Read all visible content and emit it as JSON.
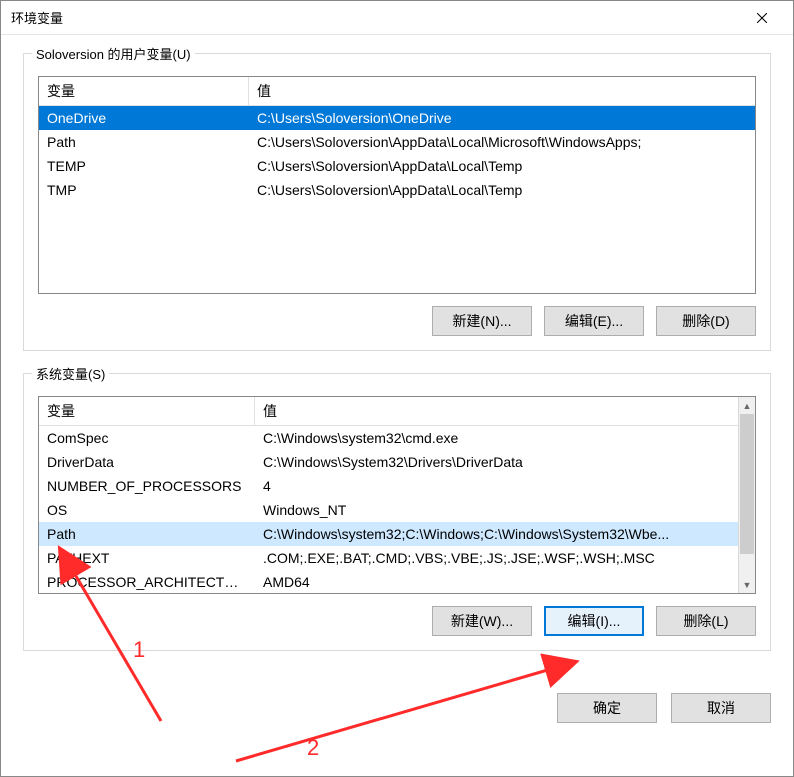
{
  "window": {
    "title": "环境变量"
  },
  "user_section": {
    "label": "Soloversion 的用户变量(U)",
    "col1": "变量",
    "col2": "值",
    "col1_width": 210,
    "rows": [
      {
        "name": "OneDrive",
        "value": "C:\\Users\\Soloversion\\OneDrive"
      },
      {
        "name": "Path",
        "value": "C:\\Users\\Soloversion\\AppData\\Local\\Microsoft\\WindowsApps;"
      },
      {
        "name": "TEMP",
        "value": "C:\\Users\\Soloversion\\AppData\\Local\\Temp"
      },
      {
        "name": "TMP",
        "value": "C:\\Users\\Soloversion\\AppData\\Local\\Temp"
      }
    ],
    "selected_index": 0,
    "buttons": {
      "new": "新建(N)...",
      "edit": "编辑(E)...",
      "del": "删除(D)"
    }
  },
  "system_section": {
    "label": "系统变量(S)",
    "col1": "变量",
    "col2": "值",
    "col1_width": 216,
    "rows": [
      {
        "name": "ComSpec",
        "value": "C:\\Windows\\system32\\cmd.exe"
      },
      {
        "name": "DriverData",
        "value": "C:\\Windows\\System32\\Drivers\\DriverData"
      },
      {
        "name": "NUMBER_OF_PROCESSORS",
        "value": "4"
      },
      {
        "name": "OS",
        "value": "Windows_NT"
      },
      {
        "name": "Path",
        "value": "C:\\Windows\\system32;C:\\Windows;C:\\Windows\\System32\\Wbe..."
      },
      {
        "name": "PATHEXT",
        "value": ".COM;.EXE;.BAT;.CMD;.VBS;.VBE;.JS;.JSE;.WSF;.WSH;.MSC"
      },
      {
        "name": "PROCESSOR_ARCHITECTURE",
        "value": "AMD64"
      }
    ],
    "selected_index": 4,
    "buttons": {
      "new": "新建(W)...",
      "edit": "编辑(I)...",
      "del": "删除(L)"
    },
    "edit_focused": true
  },
  "dialog": {
    "ok": "确定",
    "cancel": "取消"
  },
  "annotations": {
    "one": "1",
    "two": "2"
  }
}
